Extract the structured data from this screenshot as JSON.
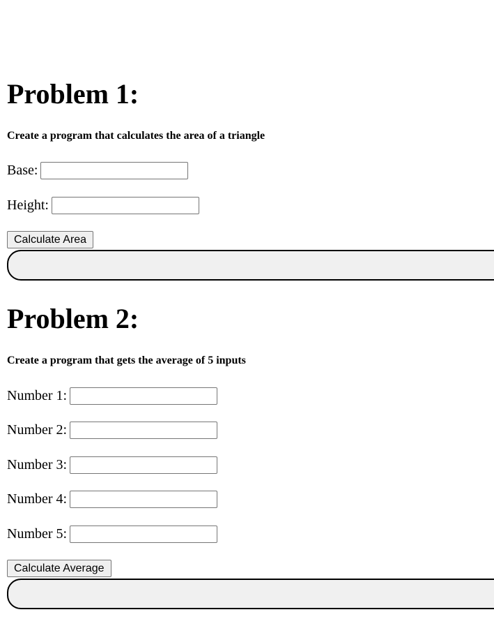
{
  "problem1": {
    "title": "Problem 1:",
    "description": "Create a program that calculates the area of a triangle",
    "fields": [
      {
        "label": "Base:",
        "value": "",
        "placeholder": ""
      },
      {
        "label": "Height:",
        "value": "",
        "placeholder": ""
      }
    ],
    "button_label": "Calculate Area",
    "result_text": ""
  },
  "problem2": {
    "title": "Problem 2:",
    "description": "Create a program that gets the average of 5 inputs",
    "fields": [
      {
        "label": "Number 1:",
        "value": "",
        "placeholder": ""
      },
      {
        "label": "Number 2:",
        "value": "",
        "placeholder": ""
      },
      {
        "label": "Number 3:",
        "value": "",
        "placeholder": ""
      },
      {
        "label": "Number 4:",
        "value": "",
        "placeholder": ""
      },
      {
        "label": "Number 5:",
        "value": "",
        "placeholder": ""
      }
    ],
    "button_label": "Calculate Average",
    "result_text": ""
  }
}
